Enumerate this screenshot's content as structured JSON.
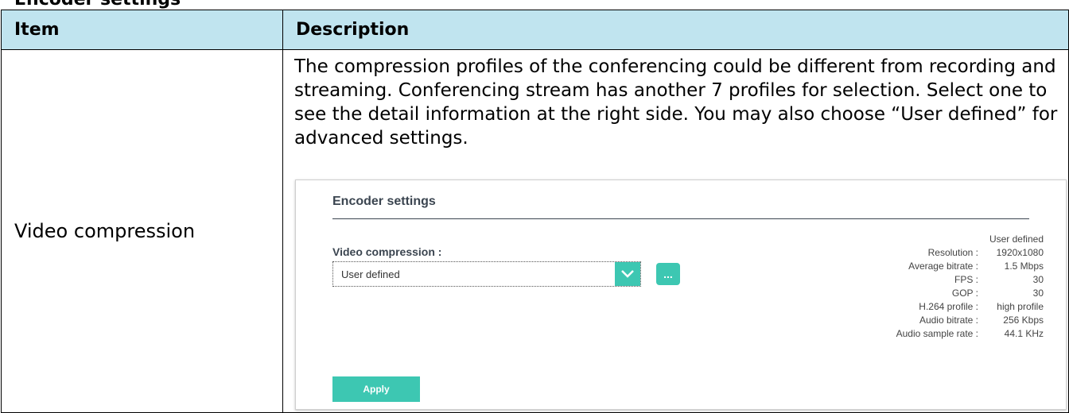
{
  "section_title": "Encoder settings",
  "table": {
    "headers": [
      "Item",
      "Description"
    ],
    "row": {
      "item": "Video compression",
      "description": "The compression profiles of the conferencing could be different from recording and streaming. Conferencing stream has another 7 profiles for selection. Select one to see the detail information at the right side. You may also choose “User defined” for advanced settings."
    }
  },
  "screenshot": {
    "title": "Encoder settings",
    "video_compression_label": "Video compression :",
    "select_value": "User defined",
    "more_button": "...",
    "apply_button": "Apply",
    "profile_name": "User defined",
    "details": [
      {
        "label": "Resolution :",
        "value": "1920x1080"
      },
      {
        "label": "Average bitrate :",
        "value": "1.5 Mbps"
      },
      {
        "label": "FPS :",
        "value": "30"
      },
      {
        "label": "GOP :",
        "value": "30"
      },
      {
        "label": "H.264 profile :",
        "value": "high profile"
      },
      {
        "label": "Audio bitrate :",
        "value": "256 Kbps"
      },
      {
        "label": "Audio sample rate :",
        "value": "44.1 KHz"
      }
    ],
    "colors": {
      "accent": "#3dc7b2",
      "header_bg": "#c0e4ef"
    }
  }
}
